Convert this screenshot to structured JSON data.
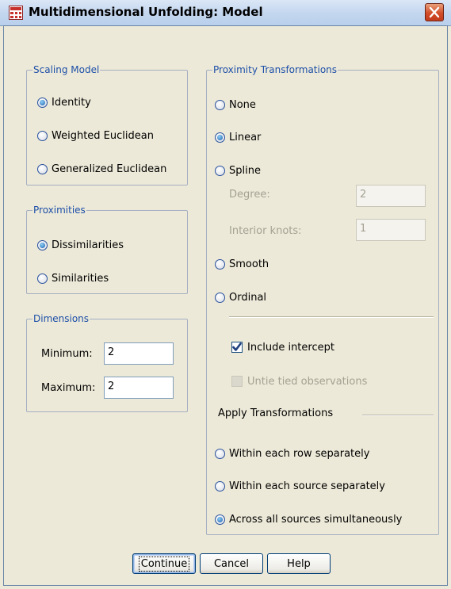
{
  "window": {
    "title": "Multidimensional Unfolding: Model"
  },
  "scaling_model": {
    "legend": "Scaling Model",
    "options": [
      "Identity",
      "Weighted Euclidean",
      "Generalized Euclidean"
    ],
    "selected": "Identity"
  },
  "proximities": {
    "legend": "Proximities",
    "options": [
      "Dissimilarities",
      "Similarities"
    ],
    "selected": "Dissimilarities"
  },
  "dimensions": {
    "legend": "Dimensions",
    "minimum_label": "Minimum:",
    "minimum_value": "2",
    "maximum_label": "Maximum:",
    "maximum_value": "2"
  },
  "proximity_transformations": {
    "legend": "Proximity Transformations",
    "options": [
      "None",
      "Linear",
      "Spline",
      "Smooth",
      "Ordinal"
    ],
    "selected": "Linear",
    "degree_label": "Degree:",
    "degree_value": "2",
    "interior_knots_label": "Interior knots:",
    "interior_knots_value": "1",
    "include_intercept_label": "Include intercept",
    "include_intercept_checked": true,
    "untie_label": "Untie tied observations",
    "untie_checked": false,
    "untie_enabled": false,
    "apply_heading": "Apply Transformations",
    "apply_options": [
      "Within each row separately",
      "Within each source separately",
      "Across all sources simultaneously"
    ],
    "apply_selected": "Across all sources simultaneously"
  },
  "buttons": {
    "continue": "Continue",
    "cancel": "Cancel",
    "help": "Help"
  },
  "icons": {
    "app": "spss-grid-icon",
    "close": "close-x-icon"
  },
  "colors": {
    "group_label": "#1d4fa8",
    "dialog_bg": "#ece9d8",
    "close_button": "#d34d2a"
  }
}
